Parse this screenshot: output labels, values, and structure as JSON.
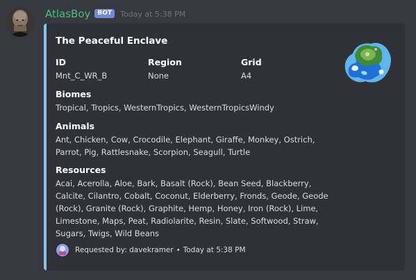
{
  "author": {
    "name": "AtlasBoy",
    "badge": "BOT",
    "timestamp": "Today at 5:38 PM",
    "name_color": "#46c47a"
  },
  "embed": {
    "accent_color": "#82c4ea",
    "title": "The Peaceful Enclave",
    "fields": {
      "id": {
        "name": "ID",
        "value": "Mnt_C_WR_B"
      },
      "region": {
        "name": "Region",
        "value": "None"
      },
      "grid": {
        "name": "Grid",
        "value": "A4"
      },
      "biomes": {
        "name": "Biomes",
        "value": "Tropical, Tropics, WesternTropics, WesternTropicsWindy"
      },
      "animals": {
        "name": "Animals",
        "value": "Ant, Chicken, Cow, Crocodile, Elephant, Giraffe, Monkey, Ostrich, Parrot, Pig, Rattlesnake, Scorpion, Seagull, Turtle"
      },
      "resources": {
        "name": "Resources",
        "value": "Acai, Acerolla, Aloe, Bark, Basalt (Rock), Bean Seed, Blackberry, Calcite, Cilantro, Cobalt, Coconut, Elderberry, Fronds, Geode, Geode (Rock), Granite (Rock), Graphite, Hemp, Honey, Iron (Rock), Lime, Limestone, Maps, Peat, Radiolarite, Resin, Slate, Softwood, Straw, Sugars, Twigs, Wild Beans"
      }
    },
    "footer": {
      "requested_by": "Requested by: davekramer",
      "separator": "•",
      "time": "Today at 5:38 PM"
    }
  }
}
